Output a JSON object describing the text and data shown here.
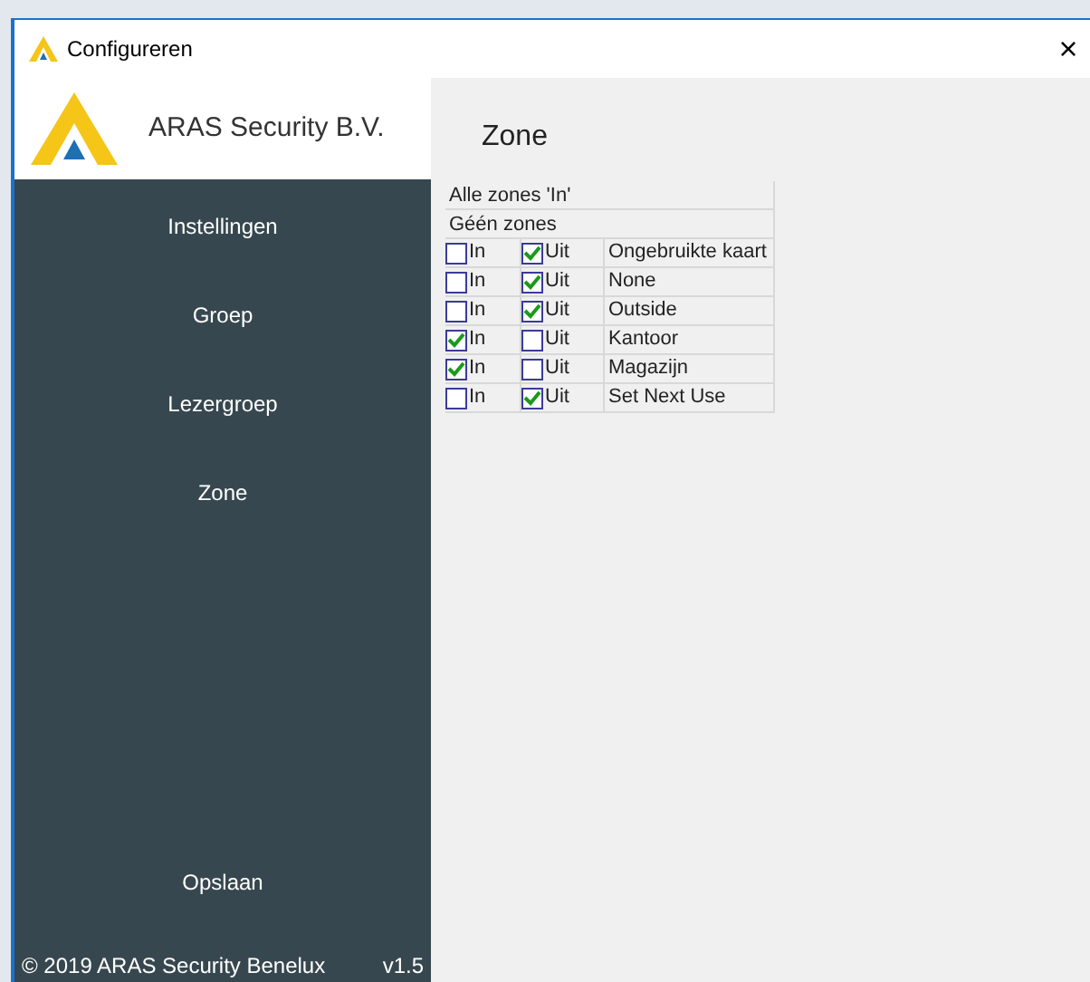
{
  "window": {
    "title": "Configureren",
    "close": "×"
  },
  "sidebar": {
    "brand": "ARAS Security B.V.",
    "items": [
      {
        "label": "Instellingen"
      },
      {
        "label": "Groep"
      },
      {
        "label": "Lezergroep"
      },
      {
        "label": "Zone"
      }
    ],
    "save": "Opslaan",
    "copyright": "© 2019 ARAS Security Benelux",
    "version": "v1.5"
  },
  "heading": "Zone",
  "table": {
    "all_in": "Alle zones 'In'",
    "none": "Géén zones",
    "rows": [
      {
        "name": "Ongebruikte kaart",
        "in_label": "In",
        "out_label": "Uit",
        "in": false,
        "out": true
      },
      {
        "name": "None",
        "in_label": "In",
        "out_label": "Uit",
        "in": false,
        "out": true
      },
      {
        "name": "Outside",
        "in_label": "In",
        "out_label": "Uit",
        "in": false,
        "out": true
      },
      {
        "name": "Kantoor",
        "in_label": "In",
        "out_label": "Uit",
        "in": true,
        "out": false
      },
      {
        "name": "Magazijn",
        "in_label": "In",
        "out_label": "Uit",
        "in": true,
        "out": false
      },
      {
        "name": "Set Next Use",
        "in_label": "In",
        "out_label": "Uit",
        "in": false,
        "out": true
      }
    ]
  }
}
